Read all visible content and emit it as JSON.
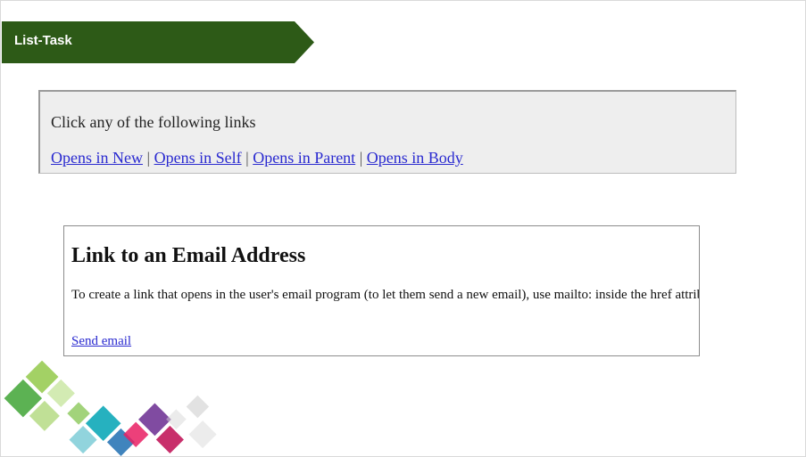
{
  "banner": {
    "title": "List-Task"
  },
  "links_panel": {
    "instruction": "Click any of the following links",
    "links": [
      {
        "label": "Opens in New"
      },
      {
        "label": "Opens in Self"
      },
      {
        "label": "Opens in Parent"
      },
      {
        "label": "Opens in Body"
      }
    ],
    "separator": "|"
  },
  "email_panel": {
    "heading": "Link to an Email Address",
    "description": "To create a link that opens in the user's email program (to let them send a new email), use mailto: inside the href attribute:",
    "link_label": "Send email"
  },
  "colors": {
    "banner_bg": "#2d5a17",
    "link": "#2a2ad0",
    "panel_bg": "#eeeeee"
  },
  "icons": [
    "decorative-diamond-pattern"
  ]
}
